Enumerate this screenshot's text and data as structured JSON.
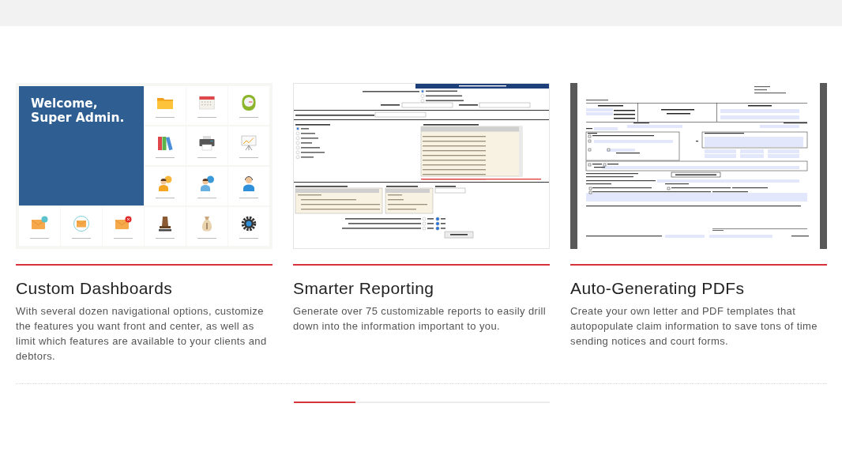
{
  "cards": [
    {
      "title": "Custom Dashboards",
      "description": "With several dozen navigational options, customize the features you want front and center, as well as limit which features are available to your clients and debtors.",
      "screenshot": {
        "kind": "dashboard",
        "welcome": "Welcome, Super Admin."
      }
    },
    {
      "title": "Smarter Reporting",
      "description": "Generate over 75 customizable reports to easily drill down into the information important to you.",
      "screenshot": {
        "kind": "report"
      }
    },
    {
      "title": "Auto-Generating PDFs",
      "description": "Create your own letter and PDF templates that autopopulate claim information to save tons of time sending notices and court forms.",
      "screenshot": {
        "kind": "form"
      }
    }
  ],
  "carousel": {
    "level": 0.24
  }
}
